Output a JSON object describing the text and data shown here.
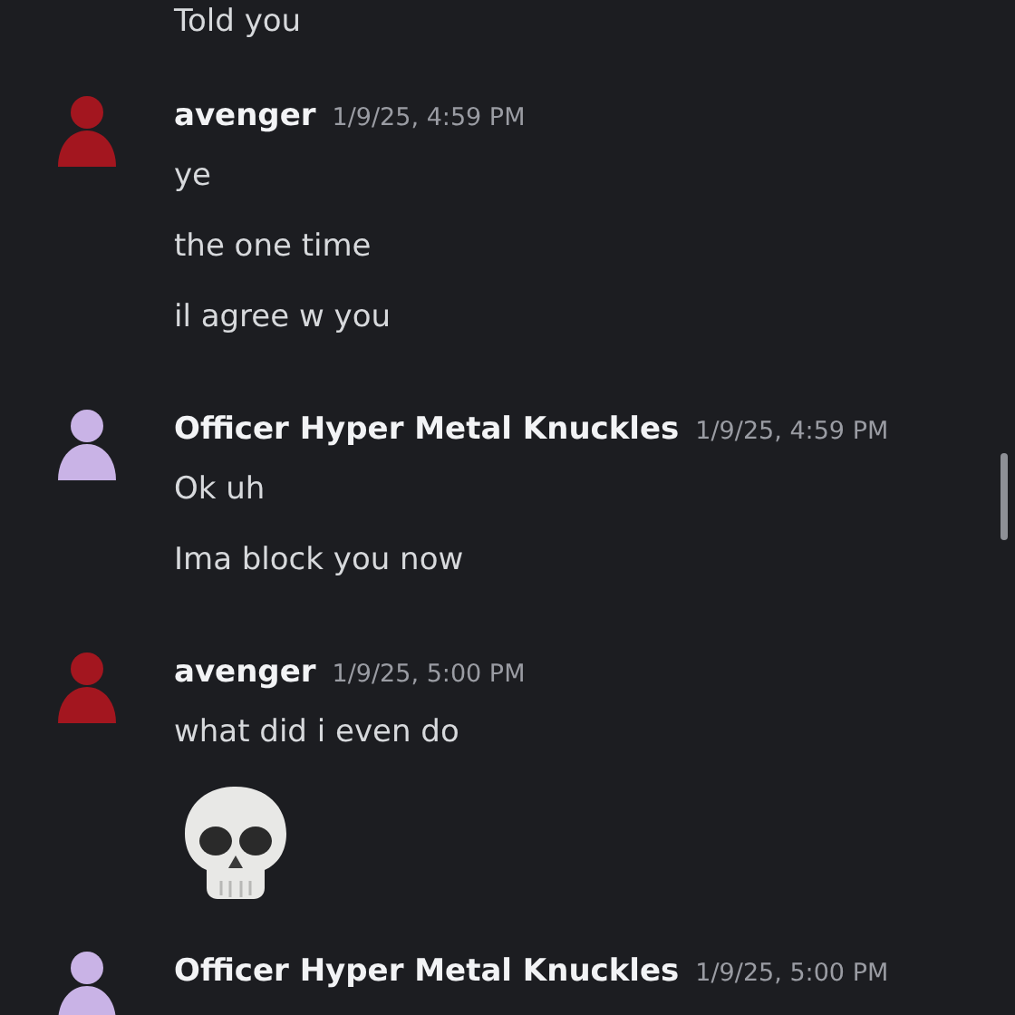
{
  "messages": [
    {
      "kind": "continuation",
      "lines": [
        {
          "kind": "text",
          "text": "Told you"
        }
      ]
    },
    {
      "kind": "group",
      "author": "avenger",
      "timestamp": "1/9/25, 4:59 PM",
      "color": "#a3161f",
      "lines": [
        {
          "kind": "text",
          "text": "ye"
        },
        {
          "kind": "text",
          "text": "the one time"
        },
        {
          "kind": "text",
          "text": "il agree w you"
        }
      ]
    },
    {
      "kind": "group",
      "author": "Officer Hyper Metal Knuckles",
      "timestamp": "1/9/25, 4:59 PM",
      "color": "#c9b3e6",
      "lines": [
        {
          "kind": "text",
          "text": "Ok uh"
        },
        {
          "kind": "text",
          "text": "Ima block you now"
        }
      ]
    },
    {
      "kind": "group",
      "author": "avenger",
      "timestamp": "1/9/25, 5:00 PM",
      "color": "#a3161f",
      "lines": [
        {
          "kind": "text",
          "text": "what did i even do"
        },
        {
          "kind": "emoji"
        }
      ]
    },
    {
      "kind": "group",
      "author": "Officer Hyper Metal Knuckles",
      "timestamp": "1/9/25, 5:00 PM",
      "color": "#c9b3e6"
    }
  ]
}
